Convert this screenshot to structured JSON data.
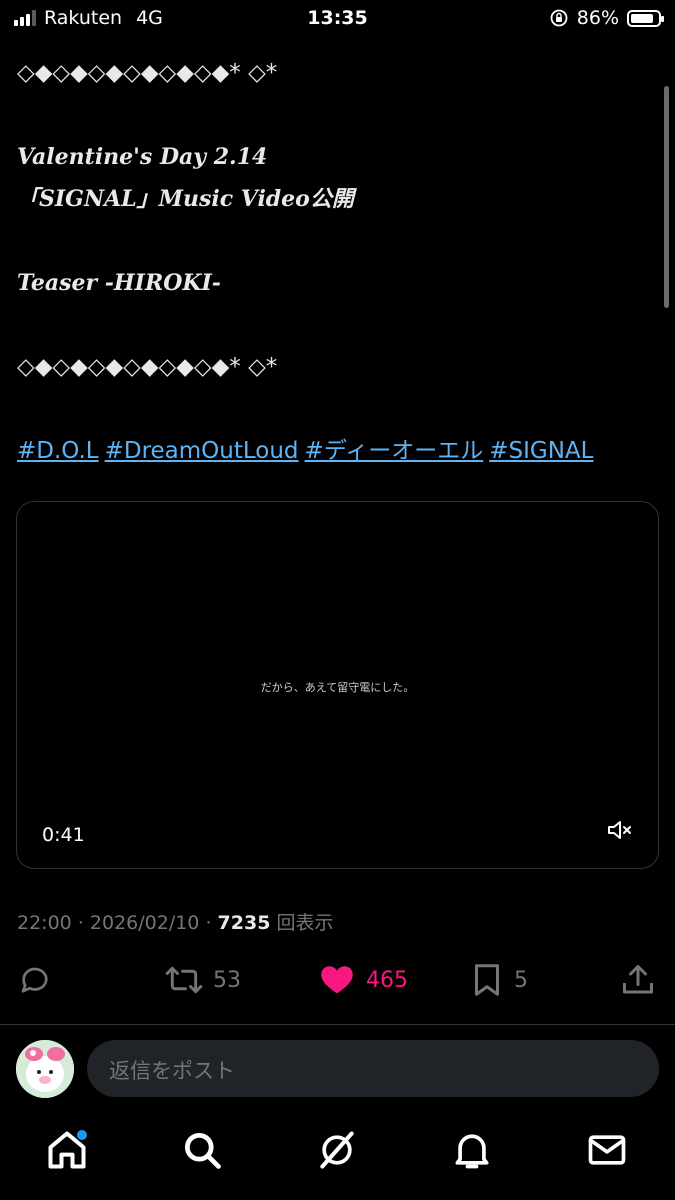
{
  "status": {
    "carrier": "Rakuten",
    "network": "4G",
    "time": "13:35",
    "battery": "86%",
    "battery_fraction": 0.86
  },
  "post": {
    "lines": [
      {
        "text": "◇◆◇◆◇◆◇◆◇◆◇◆* ◇*",
        "style": "plain"
      },
      {
        "text": "",
        "style": "gap"
      },
      {
        "text": "Valentine's Day 2.14",
        "style": "it"
      },
      {
        "text": "「SIGNAL」Music Video公開",
        "style": "it"
      },
      {
        "text": "",
        "style": "gap"
      },
      {
        "text": "Teaser -HIROKI-",
        "style": "it"
      },
      {
        "text": "",
        "style": "gap"
      },
      {
        "text": "◇◆◇◆◇◆◇◆◇◆◇◆* ◇*",
        "style": "plain"
      },
      {
        "text": "",
        "style": "gap"
      }
    ],
    "hashtags": [
      "#D.O.L",
      "#DreamOutLoud",
      "#ディーオーエル",
      "#SIGNAL"
    ],
    "video": {
      "caption": "だから、あえて留守電にした。",
      "duration": "0:41"
    },
    "meta": {
      "time": "22:00",
      "separator": " · ",
      "date": "2026/02/10",
      "views": "7235",
      "views_label": "回表示"
    },
    "actions": {
      "retweets": "53",
      "likes": "465",
      "bookmarks": "5"
    }
  },
  "reply": {
    "placeholder": "返信をポスト"
  },
  "colors": {
    "accent": "#1d9bf0",
    "like": "#f91880",
    "hashtag": "#5fb3f3",
    "muted": "#71767b"
  },
  "icons": [
    "reply-icon",
    "retweet-icon",
    "heart-icon",
    "bookmark-icon",
    "share-icon",
    "mute-icon",
    "home-icon",
    "search-icon",
    "grok-icon",
    "bell-icon",
    "mail-icon"
  ]
}
